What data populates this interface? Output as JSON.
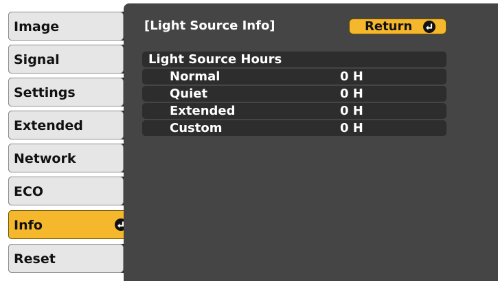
{
  "menu": {
    "items": [
      {
        "label": "Image"
      },
      {
        "label": "Signal"
      },
      {
        "label": "Settings"
      },
      {
        "label": "Extended"
      },
      {
        "label": "Network"
      },
      {
        "label": "ECO"
      },
      {
        "label": "Info"
      },
      {
        "label": "Reset"
      }
    ],
    "active": "Info"
  },
  "panel": {
    "title": "[Light Source Info]",
    "return_label": "Return",
    "section_header": "Light Source Hours",
    "rows": [
      {
        "name": "Normal",
        "value": "0 H"
      },
      {
        "name": "Quiet",
        "value": "0 H"
      },
      {
        "name": "Extended",
        "value": "0 H"
      },
      {
        "name": "Custom",
        "value": "0 H"
      }
    ]
  },
  "colors": {
    "accent": "#f5b72b",
    "panel_bg": "#454545",
    "row_bg": "#2d2d2d",
    "menu_bg": "#e6e6e6"
  },
  "icons": {
    "enter": "enter-icon"
  }
}
